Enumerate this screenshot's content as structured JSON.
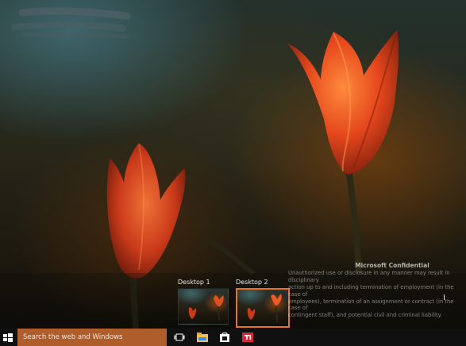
{
  "task_view": {
    "desktops": [
      {
        "label": "Desktop 1",
        "selected": false
      },
      {
        "label": "Desktop 2",
        "selected": true
      }
    ]
  },
  "watermark": {
    "title": "Microsoft Confidential",
    "lines": [
      "Unauthorized use or disclosure in any manner may result in disciplinary",
      "action up to and including termination of employment (in the case of",
      "employees), termination of an assignment or contract (in the case of",
      "contingent staff), and potential civil and criminal liability."
    ]
  },
  "taskbar": {
    "search_placeholder": "Search the web and Windows",
    "pinned": [
      {
        "icon": "task-view-icon",
        "active": false
      },
      {
        "icon": "file-explorer-icon",
        "active": false
      },
      {
        "icon": "store-icon",
        "active": false
      },
      {
        "icon": "app-red-icon",
        "active": false
      }
    ]
  },
  "colors": {
    "accent": "#e8712c",
    "search_bg": "#b05d2c",
    "taskbar_bg": "#101010"
  }
}
